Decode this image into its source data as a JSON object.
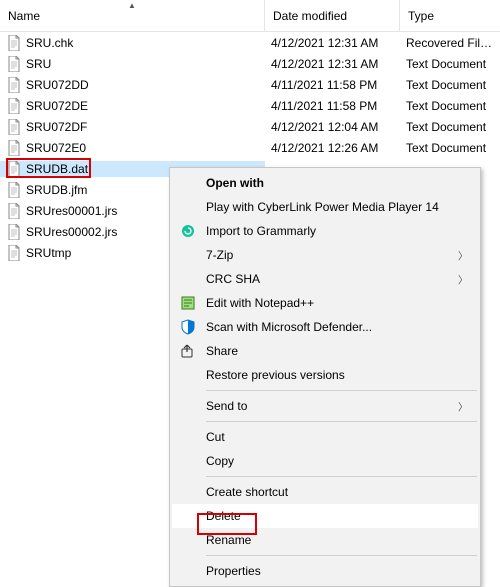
{
  "columns": {
    "name": "Name",
    "date": "Date modified",
    "type": "Type"
  },
  "files": [
    {
      "name": "SRU.chk",
      "date": "4/12/2021 12:31 AM",
      "type": "Recovered File Fr"
    },
    {
      "name": "SRU",
      "date": "4/12/2021 12:31 AM",
      "type": "Text Document"
    },
    {
      "name": "SRU072DD",
      "date": "4/11/2021 11:58 PM",
      "type": "Text Document"
    },
    {
      "name": "SRU072DE",
      "date": "4/11/2021 11:58 PM",
      "type": "Text Document"
    },
    {
      "name": "SRU072DF",
      "date": "4/12/2021 12:04 AM",
      "type": "Text Document"
    },
    {
      "name": "SRU072E0",
      "date": "4/12/2021 12:26 AM",
      "type": "Text Document"
    },
    {
      "name": "SRUDB.dat",
      "date": "",
      "type": ""
    },
    {
      "name": "SRUDB.jfm",
      "date": "",
      "type": ""
    },
    {
      "name": "SRUres00001.jrs",
      "date": "",
      "type": ""
    },
    {
      "name": "SRUres00002.jrs",
      "date": "",
      "type": ""
    },
    {
      "name": "SRUtmp",
      "date": "",
      "type": ""
    }
  ],
  "selected_index": 6,
  "menu": {
    "open_with": "Open with",
    "play_clpm": "Play with CyberLink Power Media Player 14",
    "import_grammarly": "Import to Grammarly",
    "seven_zip": "7-Zip",
    "crc_sha": "CRC SHA",
    "edit_notepadpp": "Edit with Notepad++",
    "scan_defender": "Scan with Microsoft Defender...",
    "share": "Share",
    "restore_prev": "Restore previous versions",
    "send_to": "Send to",
    "cut": "Cut",
    "copy": "Copy",
    "create_shortcut": "Create shortcut",
    "delete": "Delete",
    "rename": "Rename",
    "properties": "Properties"
  }
}
